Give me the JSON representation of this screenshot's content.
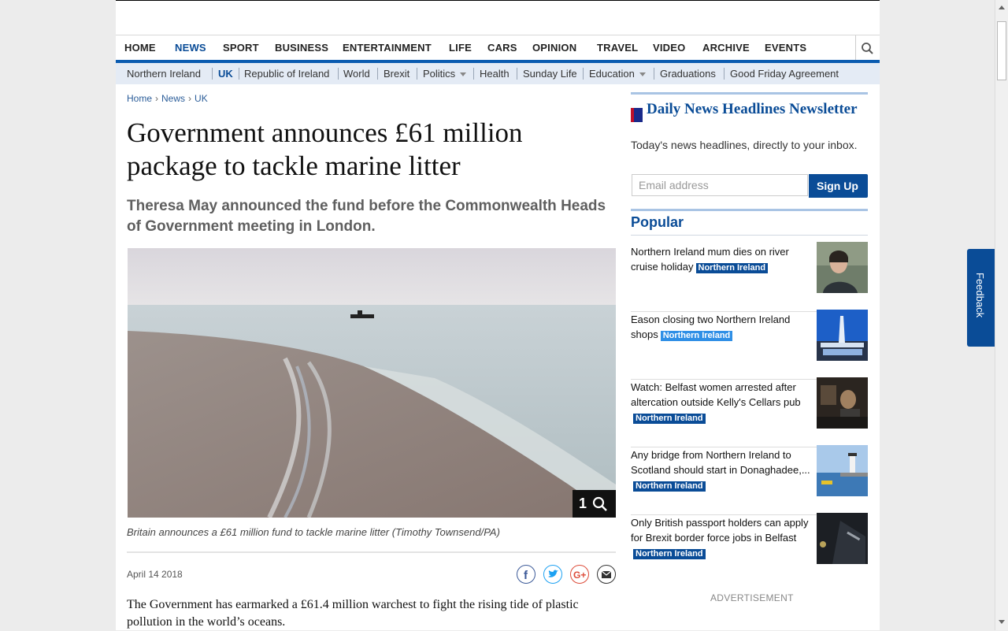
{
  "nav": {
    "items": [
      "HOME",
      "NEWS",
      "SPORT",
      "BUSINESS",
      "ENTERTAINMENT",
      "LIFE",
      "CARS",
      "OPINION",
      "TRAVEL",
      "VIDEO",
      "ARCHIVE",
      "EVENTS"
    ],
    "active": "NEWS"
  },
  "subnav": {
    "items": [
      "Northern Ireland",
      "UK",
      "Republic of Ireland",
      "World",
      "Brexit",
      "Politics",
      "Health",
      "Sunday Life",
      "Education",
      "Graduations",
      "Good Friday Agreement"
    ],
    "active": "UK"
  },
  "breadcrumb": [
    "Home",
    "News",
    "UK"
  ],
  "article": {
    "title": "Government announces £61 million package to tackle marine litter",
    "subhead": "Theresa May announced the fund before the Commonwealth Heads of Government meeting in London.",
    "gallery_count": "1",
    "caption": "Britain announces a £61 million fund to tackle marine litter (Timothy Townsend/PA)",
    "date": "April 14 2018",
    "body": "The Government has earmarked a £61.4 million warchest to fight the rising tide of plastic pollution in the world’s oceans."
  },
  "newsletter": {
    "title": "Daily News Headlines Newsletter",
    "text": "Today's news headlines, directly to your inbox.",
    "placeholder": "Email address",
    "button": "Sign Up"
  },
  "popular": {
    "title": "Popular",
    "items": [
      {
        "text": "Northern Ireland mum dies on river cruise holiday",
        "tag": "Northern Ireland"
      },
      {
        "text": "Eason closing two Northern Ireland shops",
        "tag": "Northern Ireland"
      },
      {
        "text": "Watch: Belfast women arrested after altercation outside Kelly's Cellars pub",
        "tag": "Northern Ireland"
      },
      {
        "text": "Any bridge from Northern Ireland to Scotland should start in Donaghadee,...",
        "tag": "Northern Ireland"
      },
      {
        "text": "Only British passport holders can apply for Brexit border force jobs in Belfast",
        "tag": "Northern Ireland"
      }
    ]
  },
  "advertisement": "ADVERTISEMENT",
  "feedback": "Feedback",
  "colors": {
    "brand": "#0a4c97",
    "subnav_bg": "#e4ebf5",
    "accent_light": "#2f8fe6"
  }
}
